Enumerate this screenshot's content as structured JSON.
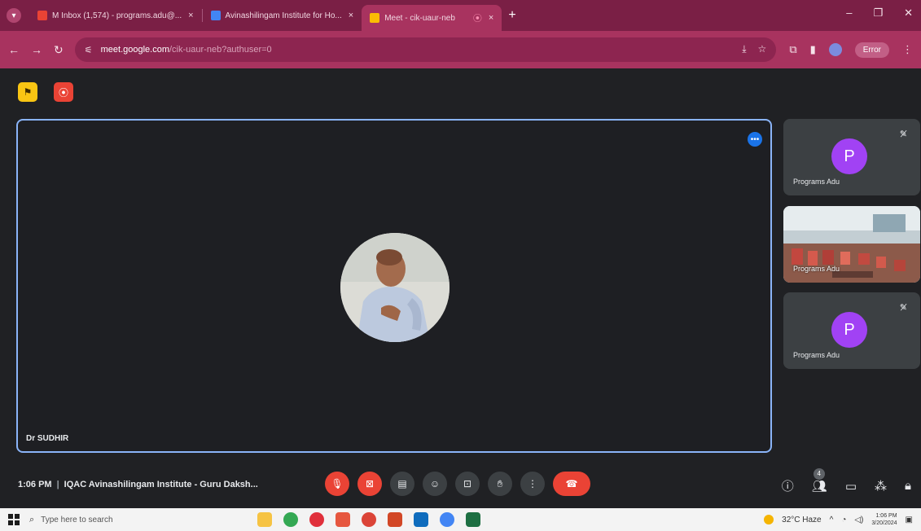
{
  "browser": {
    "tabs": [
      {
        "label": "M Inbox (1,574) - programs.adu@...",
        "active": false,
        "favicon_color": "#ea4335"
      },
      {
        "label": "Avinashilingam Institute for Ho...",
        "active": false,
        "favicon_color": "#4285f4"
      },
      {
        "label": "Meet - cik-uaur-neb",
        "active": true,
        "favicon_color": "#fbbc04"
      }
    ],
    "tab_close": "×",
    "recording_dot": "⦿",
    "new_tab": "+",
    "window_controls": {
      "minimize": "–",
      "restore": "❐",
      "close": "✕"
    },
    "url_host": "meet.google.com",
    "url_path": "/cik-uaur-neb?authuser=0",
    "error_label": "Error",
    "accent_color": "#a8335f"
  },
  "meet": {
    "presenter_name": "Dr SUDHIR",
    "side_tiles": [
      {
        "name": "Programs Adu",
        "avatar_letter": "P",
        "muted": true
      },
      {
        "name": "Programs Adu",
        "avatar_letter": "",
        "muted": false
      },
      {
        "name": "Programs Adu",
        "avatar_letter": "P",
        "muted": true
      }
    ],
    "time": "1:06 PM",
    "separator": "|",
    "meeting_title": "IQAC Avinashilingam Institute - Guru Daksh...",
    "participant_count": "4",
    "avatar_color": "#a142f4"
  },
  "taskbar": {
    "search_placeholder": "Type here to search",
    "weather": "32°C Haze",
    "clock_time": "1:06 PM",
    "clock_date": "3/20/2024"
  }
}
